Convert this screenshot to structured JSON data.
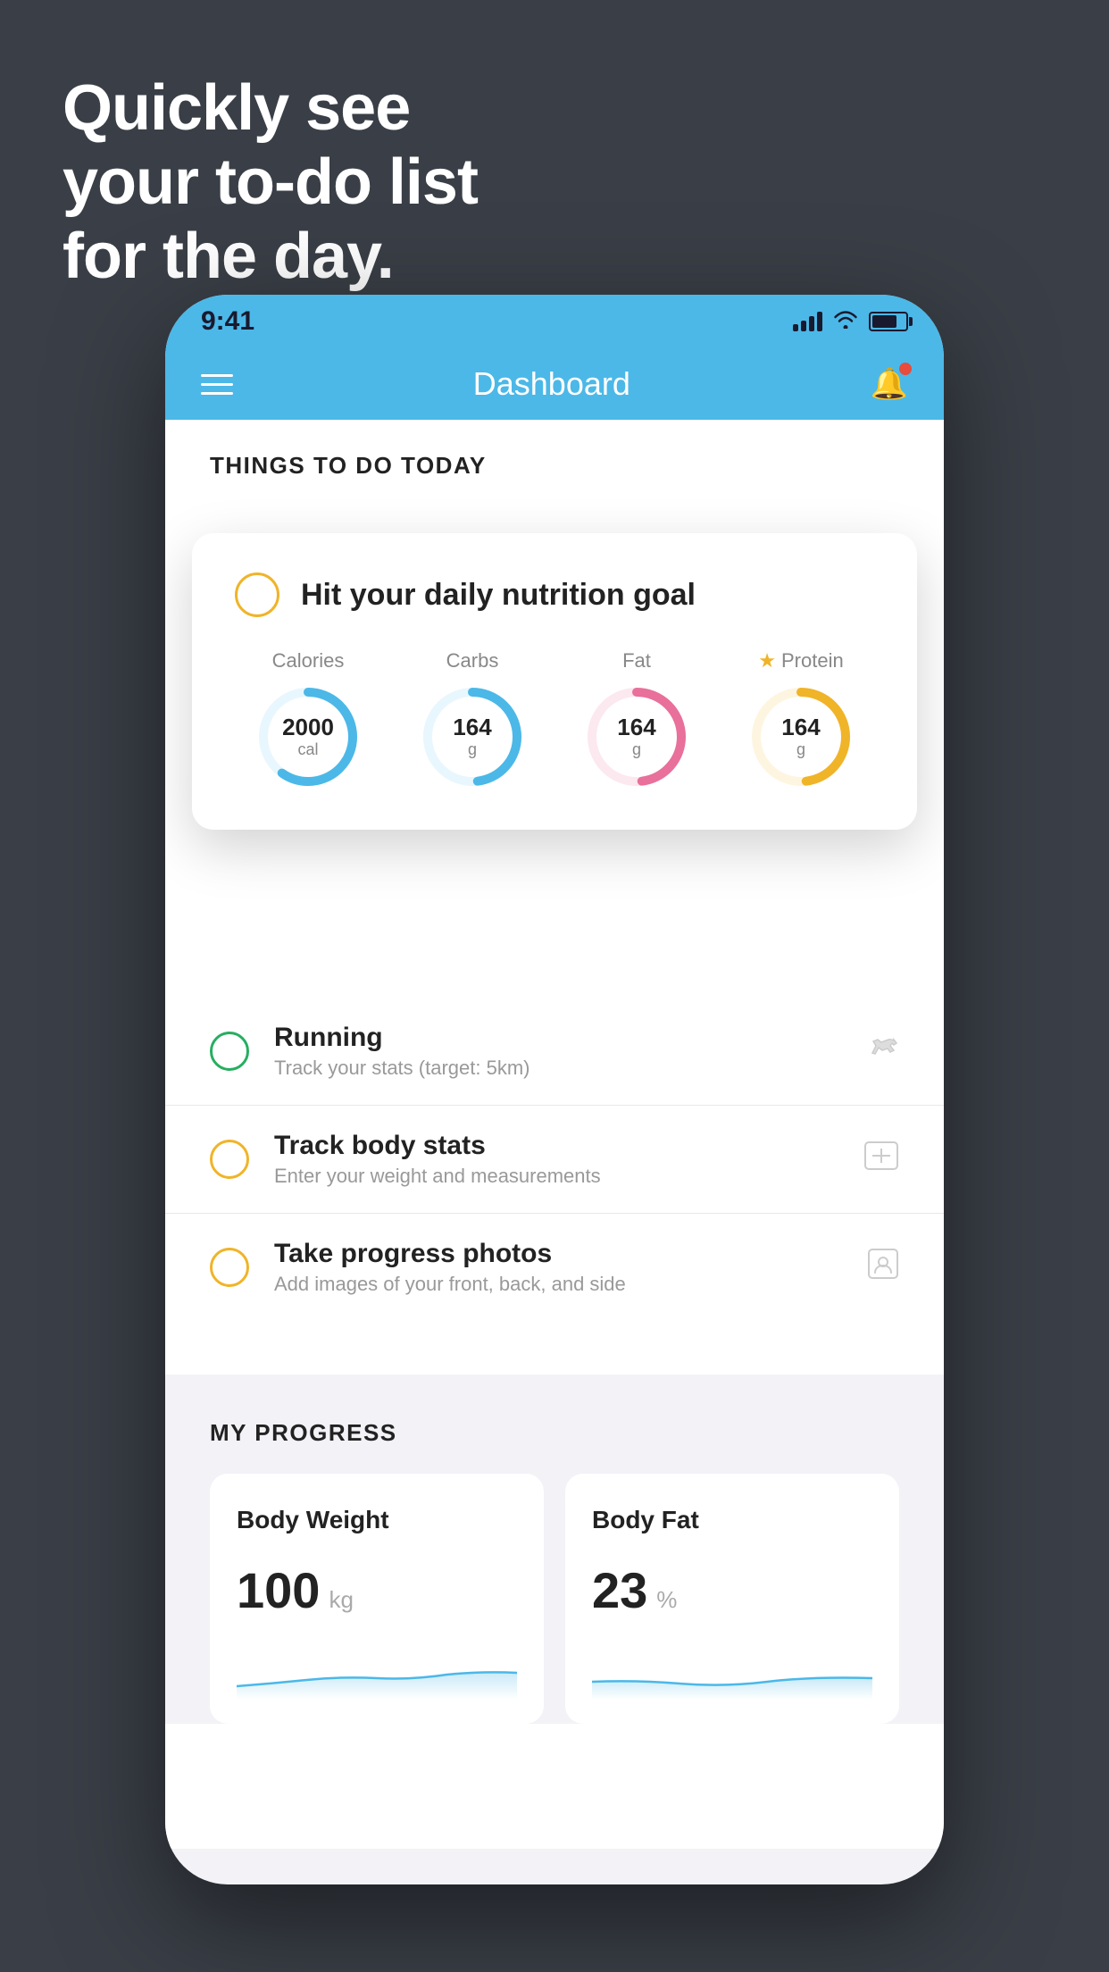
{
  "background": {
    "headline_line1": "Quickly see",
    "headline_line2": "your to-do list",
    "headline_line3": "for the day."
  },
  "phone": {
    "status_bar": {
      "time": "9:41"
    },
    "nav_bar": {
      "title": "Dashboard"
    },
    "things_section": {
      "title": "THINGS TO DO TODAY"
    },
    "floating_card": {
      "title": "Hit your daily nutrition goal",
      "nutrition": [
        {
          "label": "Calories",
          "value": "2000",
          "unit": "cal",
          "color": "#4bb8e8",
          "track_color": "#4bb8e8",
          "highlight": false
        },
        {
          "label": "Carbs",
          "value": "164",
          "unit": "g",
          "color": "#4bb8e8",
          "track_color": "#4bb8e8",
          "highlight": false
        },
        {
          "label": "Fat",
          "value": "164",
          "unit": "g",
          "color": "#e8709a",
          "track_color": "#e8709a",
          "highlight": false
        },
        {
          "label": "Protein",
          "value": "164",
          "unit": "g",
          "color": "#f0b429",
          "track_color": "#f0b429",
          "highlight": true
        }
      ]
    },
    "todo_items": [
      {
        "id": "running",
        "name": "Running",
        "desc": "Track your stats (target: 5km)",
        "circle_color": "green",
        "icon": "👟"
      },
      {
        "id": "track-body",
        "name": "Track body stats",
        "desc": "Enter your weight and measurements",
        "circle_color": "yellow",
        "icon": "⚖"
      },
      {
        "id": "progress-photos",
        "name": "Take progress photos",
        "desc": "Add images of your front, back, and side",
        "circle_color": "yellow",
        "icon": "🖼"
      }
    ],
    "my_progress": {
      "title": "MY PROGRESS",
      "cards": [
        {
          "title": "Body Weight",
          "value": "100",
          "unit": "kg"
        },
        {
          "title": "Body Fat",
          "value": "23",
          "unit": "%"
        }
      ]
    }
  }
}
